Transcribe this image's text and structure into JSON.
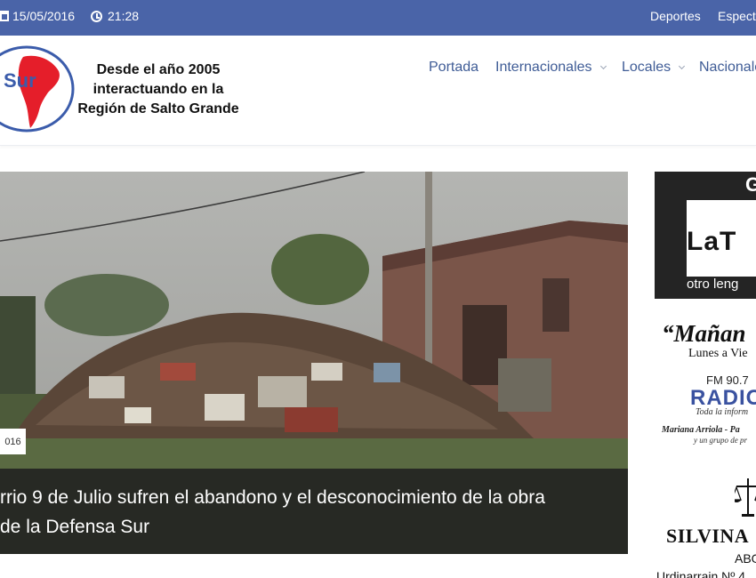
{
  "topbar": {
    "date": "15/05/2016",
    "time": "21:28",
    "links": [
      "Deportes",
      "Espectá"
    ],
    "icons": [
      "calendar-icon",
      "clock-icon"
    ],
    "colors": {
      "background": "#4a64a8",
      "text": "#ffffff"
    }
  },
  "header": {
    "logo_text": "Sur",
    "tagline": [
      "Desde el año 2005",
      "interactuando en la",
      "Región de Salto Grande"
    ],
    "nav": [
      {
        "label": "Portada",
        "dropdown": false
      },
      {
        "label": "Internacionales",
        "dropdown": true
      },
      {
        "label": "Locales",
        "dropdown": true
      },
      {
        "label": "Nacionale",
        "dropdown": false
      }
    ],
    "colors": {
      "nav_text": "#3f5c96",
      "logo_blue": "#3b5cab",
      "logo_red": "#e51e2a"
    }
  },
  "featured": {
    "date_badge": "016",
    "headline_lines": [
      "rrio 9 de Julio sufren el abandono y el desconocimiento de la obra",
      "de la Defensa Sur"
    ]
  },
  "sidebar": {
    "ad1": {
      "top_letter": "G",
      "main": "LaT",
      "sub": "otro leng"
    },
    "ad2": {
      "title": "“Mañan",
      "line2": "Lunes a Vie",
      "line3": "FM 90.7",
      "line4": "RADIO",
      "line5": "Toda la inform",
      "line6": "Mariana Arriola - Pa",
      "line7": "y un grupo de pr"
    },
    "ad3": {
      "name": "SILVINA",
      "title": "ABG",
      "address": "Urdinarrain Nº 4"
    }
  }
}
